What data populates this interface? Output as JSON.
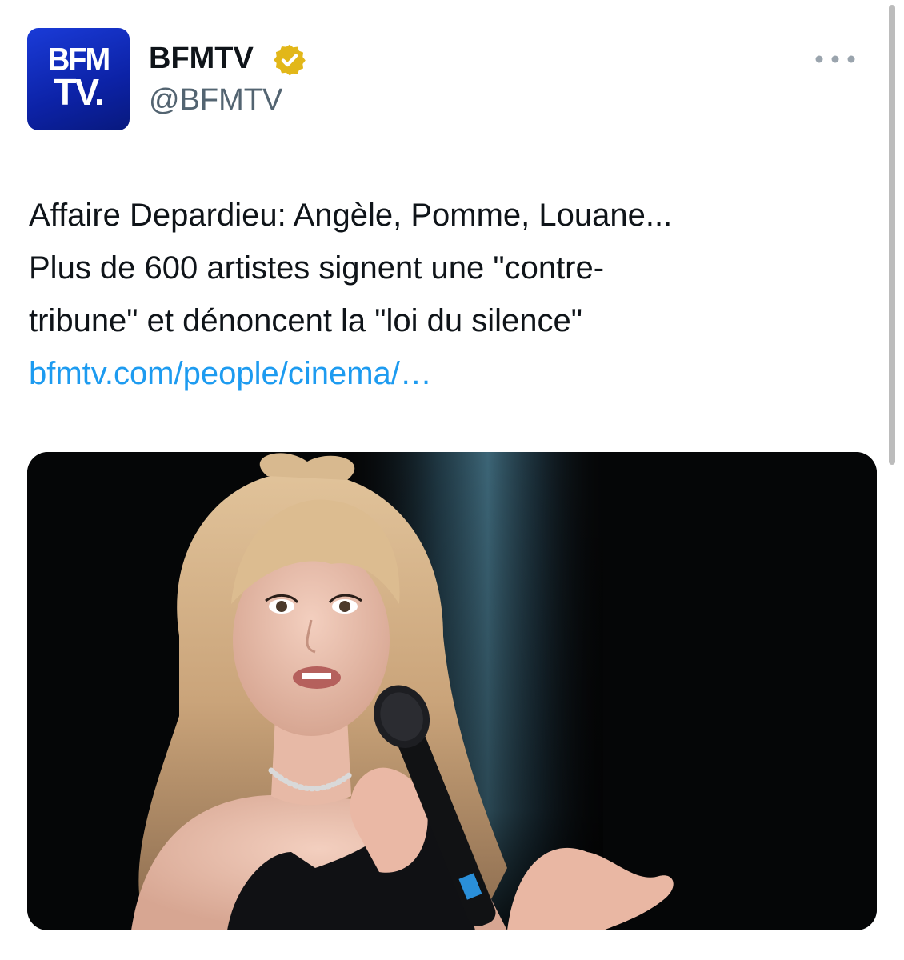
{
  "author": {
    "avatar_text_line1": "BFM",
    "avatar_text_line2": "TV.",
    "display_name": "BFMTV",
    "handle": "@BFMTV",
    "verified_badge": "verified-gold-check",
    "brand_color": "#1b33c8",
    "badge_color": "#e2b719"
  },
  "menu": {
    "icon": "more-horizontal-icon"
  },
  "tweet": {
    "lines": [
      "Affaire Depardieu: Angèle, Pomme, Louane...",
      "Plus de 600 artistes signent une \"contre-",
      "tribune\" et dénoncent la \"loi du silence\""
    ],
    "link_text": "bfmtv.com/people/cinema/…",
    "link_color": "#1d9bf0"
  }
}
